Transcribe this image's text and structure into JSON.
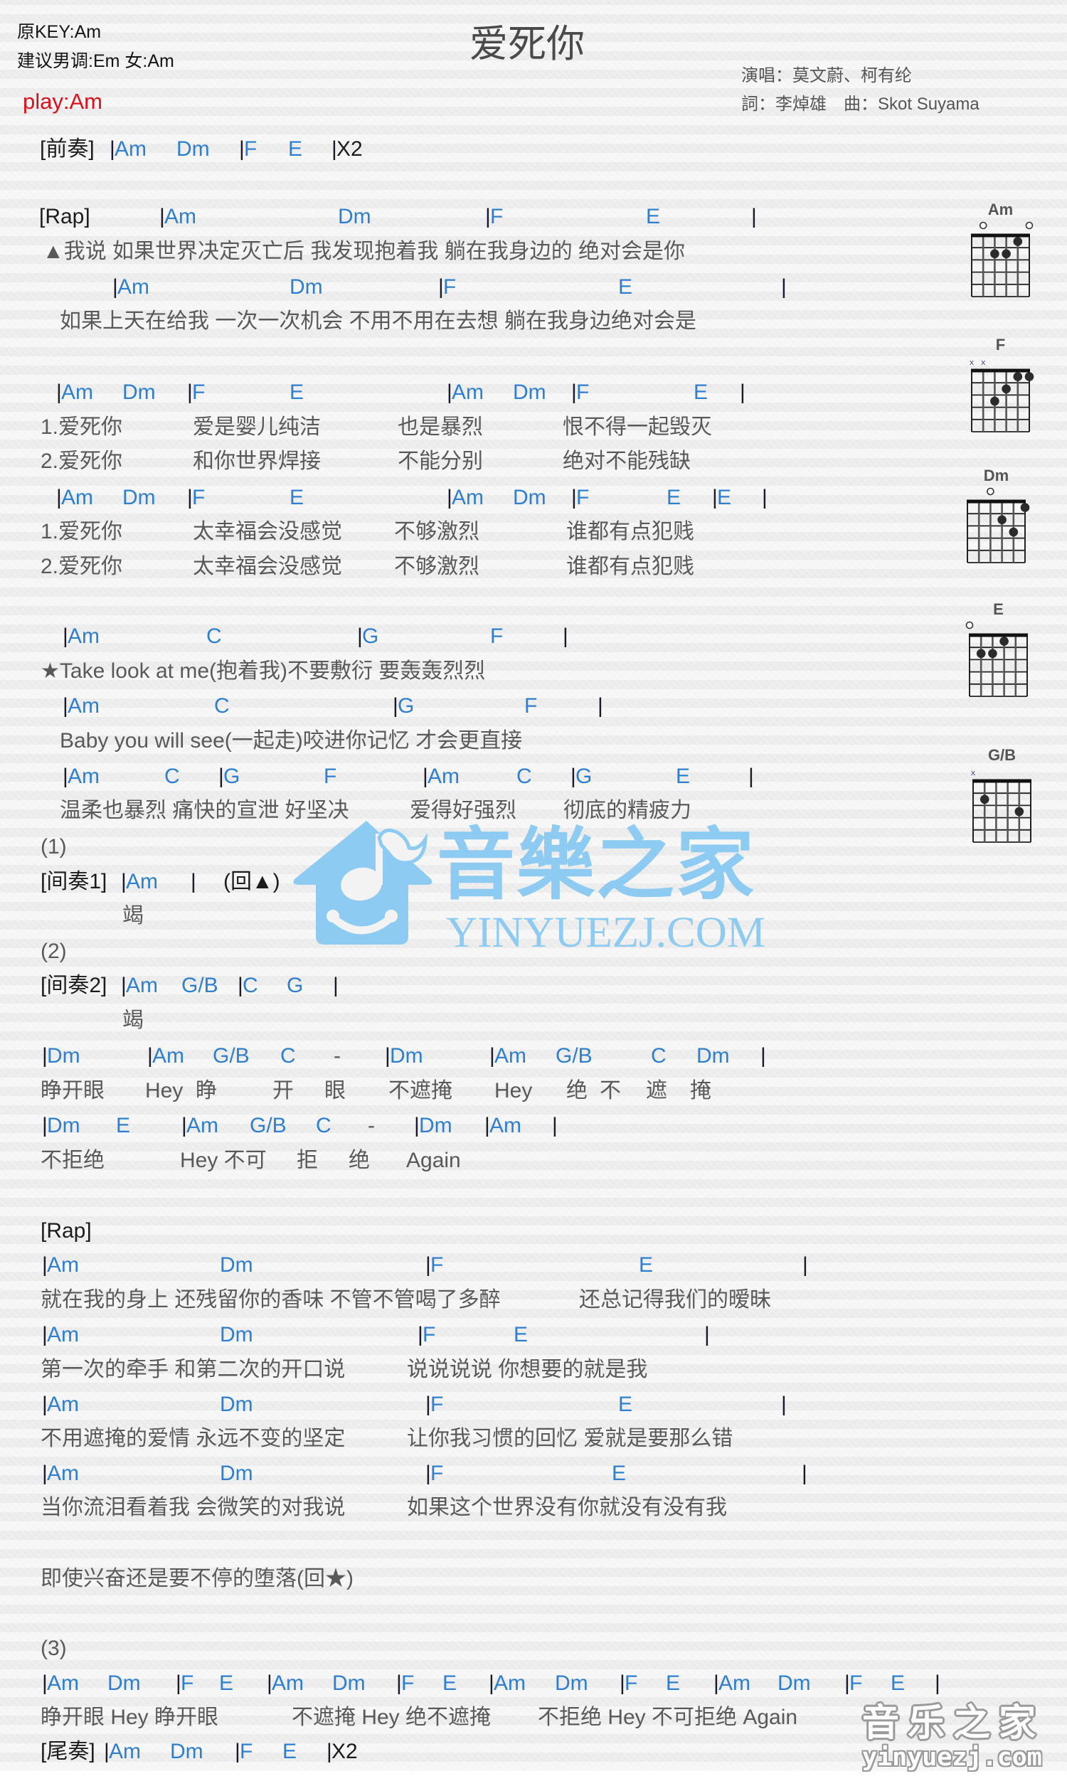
{
  "header": {
    "original_key": "原KEY:Am",
    "suggested_key": "建议男调:Em 女:Am",
    "play_key": "play:Am",
    "title": "爱死你",
    "singers": "演唱：莫文蔚、柯有纶",
    "credits": "詞：李焯雄　曲：Skot Suyama"
  },
  "colors": {
    "chord": "#2f7fd1",
    "lyric": "#595959",
    "label": "#1c1c1c",
    "bar": "#1a1a2a",
    "play_key": "#e0101a",
    "title": "#4a4a4a",
    "watermark": "#8ecbf2"
  },
  "chord_diagrams": [
    {
      "name": "Am",
      "markers": [
        "",
        "o",
        "",
        "",
        "",
        "o"
      ],
      "dots": [
        {
          "string": 5,
          "fret": 1
        },
        {
          "string": 3,
          "fret": 2
        },
        {
          "string": 4,
          "fret": 2
        }
      ]
    },
    {
      "name": "F",
      "markers": [
        "x",
        "x",
        "",
        "",
        "",
        ""
      ],
      "dots": [
        {
          "string": 5,
          "fret": 1
        },
        {
          "string": 6,
          "fret": 1
        },
        {
          "string": 4,
          "fret": 2
        },
        {
          "string": 3,
          "fret": 3
        }
      ]
    },
    {
      "name": "Dm",
      "markers": [
        "",
        "",
        "o",
        "",
        "",
        ""
      ],
      "dots": [
        {
          "string": 6,
          "fret": 1
        },
        {
          "string": 4,
          "fret": 2
        },
        {
          "string": 5,
          "fret": 3
        }
      ]
    },
    {
      "name": "E",
      "markers": [
        "o",
        "",
        "",
        "",
        "",
        ""
      ],
      "dots": [
        {
          "string": 4,
          "fret": 1
        },
        {
          "string": 2,
          "fret": 2
        },
        {
          "string": 3,
          "fret": 2
        }
      ]
    },
    {
      "name": "G/B",
      "markers": [
        "x",
        "",
        "",
        "",
        "",
        ""
      ],
      "dots": [
        {
          "string": 2,
          "fret": 2
        },
        {
          "string": 5,
          "fret": 3
        }
      ]
    }
  ],
  "sheet": {
    "lines": [
      {
        "kind": "chords",
        "t": [
          "[前奏]",
          "|",
          "Am",
          "Dm",
          "|",
          "F",
          "E",
          "|",
          "X2"
        ]
      },
      {
        "kind": "chords",
        "t": [
          "[Rap]",
          "|",
          "Am",
          "Dm",
          "|",
          "F",
          "E",
          "|"
        ]
      },
      {
        "kind": "lyrics",
        "t": [
          "▲我说 如果世界决定灭亡后 我发现抱着我 躺在我身边的 绝对会是你"
        ]
      },
      {
        "kind": "chords",
        "t": [
          "|",
          "Am",
          "Dm",
          "|",
          "F",
          "E",
          "|"
        ]
      },
      {
        "kind": "lyrics",
        "t": [
          "如果上天在给我 一次一次机会 不用不用在去想 躺在我身边绝对会是"
        ]
      },
      {
        "kind": "chords",
        "t": [
          "|",
          "Am",
          "Dm",
          "|",
          "F",
          "E",
          "|",
          "Am",
          "Dm",
          "|",
          "F",
          "E",
          "|"
        ]
      },
      {
        "kind": "lyrics",
        "t": [
          "1.爱死你",
          "爱是婴儿纯洁",
          "也是暴烈",
          "恨不得一起毁灭"
        ]
      },
      {
        "kind": "lyrics",
        "t": [
          "2.爱死你",
          "和你世界焊接",
          "不能分别",
          "绝对不能残缺"
        ]
      },
      {
        "kind": "chords",
        "t": [
          "|",
          "Am",
          "Dm",
          "|",
          "F",
          "E",
          "|",
          "Am",
          "Dm",
          "|",
          "F",
          "E",
          "|",
          "E",
          "|"
        ]
      },
      {
        "kind": "lyrics",
        "t": [
          "1.爱死你",
          "太幸福会没感觉",
          "不够激烈",
          "谁都有点犯贱"
        ]
      },
      {
        "kind": "lyrics",
        "t": [
          "2.爱死你",
          "太幸福会没感觉",
          "不够激烈",
          "谁都有点犯贱"
        ]
      },
      {
        "kind": "chords",
        "t": [
          "|",
          "Am",
          "C",
          "|",
          "G",
          "F",
          "|"
        ]
      },
      {
        "kind": "lyrics",
        "t": [
          "★Take look at me(抱着我)不要敷衍 要轰轰烈烈"
        ]
      },
      {
        "kind": "chords",
        "t": [
          "|",
          "Am",
          "C",
          "|",
          "G",
          "F",
          "|"
        ]
      },
      {
        "kind": "lyrics",
        "t": [
          "Baby you will see(一起走)咬进你记忆 才会更直接"
        ]
      },
      {
        "kind": "chords",
        "t": [
          "|",
          "Am",
          "C",
          "|",
          "G",
          "F",
          "|",
          "Am",
          "C",
          "|",
          "G",
          "E",
          "|"
        ]
      },
      {
        "kind": "lyrics",
        "t": [
          "温柔也暴烈 痛快的宣泄 好坚决",
          "爱得好强烈",
          "彻底的精疲力"
        ]
      },
      {
        "kind": "marker",
        "t": [
          "(1)"
        ]
      },
      {
        "kind": "chords",
        "t": [
          "[间奏1]",
          "|",
          "Am",
          "|",
          "(回▲)"
        ]
      },
      {
        "kind": "lyrics",
        "t": [
          "竭"
        ]
      },
      {
        "kind": "marker",
        "t": [
          "(2)"
        ]
      },
      {
        "kind": "chords",
        "t": [
          "[间奏2]",
          "|",
          "Am",
          "G/B",
          "|",
          "C",
          "G",
          "|"
        ]
      },
      {
        "kind": "lyrics",
        "t": [
          "竭"
        ]
      },
      {
        "kind": "chords",
        "t": [
          "|",
          "Dm",
          "|",
          "Am",
          "G/B",
          "C",
          "-",
          "|",
          "Dm",
          "|",
          "Am",
          "G/B",
          "C",
          "Dm",
          "|"
        ]
      },
      {
        "kind": "lyrics",
        "t": [
          "睁开眼",
          "Hey",
          "睁",
          "开",
          "眼",
          "不遮掩",
          "Hey",
          "绝",
          "不",
          "遮",
          "掩"
        ]
      },
      {
        "kind": "chords",
        "t": [
          "|",
          "Dm",
          "E",
          "|",
          "Am",
          "G/B",
          "C",
          "-",
          "|",
          "Dm",
          "|",
          "Am",
          "|"
        ]
      },
      {
        "kind": "lyrics",
        "t": [
          "不拒绝",
          "Hey 不可",
          "拒",
          "绝",
          "Again"
        ]
      },
      {
        "kind": "section",
        "t": [
          "[Rap]"
        ]
      },
      {
        "kind": "chords",
        "t": [
          "|",
          "Am",
          "Dm",
          "|",
          "F",
          "E",
          "|"
        ]
      },
      {
        "kind": "lyrics",
        "t": [
          "就在我的身上 还残留你的香味 不管不管喝了多醉",
          "还总记得我们的暧昧"
        ]
      },
      {
        "kind": "chords",
        "t": [
          "|",
          "Am",
          "Dm",
          "|",
          "F",
          "E",
          "|"
        ]
      },
      {
        "kind": "lyrics",
        "t": [
          "第一次的牵手 和第二次的开口说",
          "说说说说 你想要的就是我"
        ]
      },
      {
        "kind": "chords",
        "t": [
          "|",
          "Am",
          "Dm",
          "|",
          "F",
          "E",
          "|"
        ]
      },
      {
        "kind": "lyrics",
        "t": [
          "不用遮掩的爱情 永远不变的坚定",
          "让你我习惯的回忆 爱就是要那么错"
        ]
      },
      {
        "kind": "chords",
        "t": [
          "|",
          "Am",
          "Dm",
          "|",
          "F",
          "E",
          "|"
        ]
      },
      {
        "kind": "lyrics",
        "t": [
          "当你流泪看着我 会微笑的对我说",
          "如果这个世界没有你就没有没有我"
        ]
      },
      {
        "kind": "lyrics",
        "t": [
          "即使兴奋还是要不停的堕落(回★)"
        ]
      },
      {
        "kind": "marker",
        "t": [
          "(3)"
        ]
      },
      {
        "kind": "chords",
        "t": [
          "|",
          "Am",
          "Dm",
          "|",
          "F",
          "E",
          "|",
          "Am",
          "Dm",
          "|",
          "F",
          "E",
          "|",
          "Am",
          "Dm",
          "|",
          "F",
          "E",
          "|",
          "Am",
          "Dm",
          "|",
          "F",
          "E",
          "|"
        ]
      },
      {
        "kind": "lyrics",
        "t": [
          "睁开眼 Hey 睁开眼",
          "不遮掩 Hey 绝不遮掩",
          "不拒绝 Hey 不可拒绝 Again"
        ]
      },
      {
        "kind": "chords",
        "t": [
          "[尾奏]",
          "|",
          "Am",
          "Dm",
          "|",
          "F",
          "E",
          "|",
          "X2"
        ]
      }
    ]
  },
  "watermark": {
    "logo_name": "音樂之家",
    "logo_url": "YINYUEZJ.COM",
    "corner_name": "音乐之家",
    "corner_url": "yinyuezj.com"
  }
}
